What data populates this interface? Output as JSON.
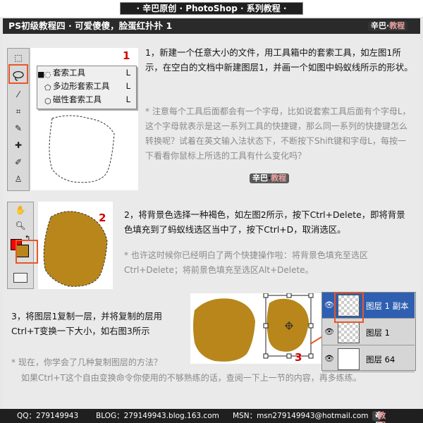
{
  "header": {
    "title": "· 辛巴原创 · PhotoShop · 系列教程 ·",
    "subtitle": "PS初级教程四 · 可爱傻傻，脸蛋红扑扑 1",
    "watermark_a": "辛巴",
    "watermark_b": "教程"
  },
  "step1": {
    "number": "1",
    "text": "1，新建一个任意大小的文件，用工具箱中的套索工具，如左图1所示，在空白的文档中新建图层1，并画一个如图中蚂蚁线所示的形状。",
    "note": "* 注意每个工具后面都会有一个字母，比如说套索工具后面有个字母L，这个字母就表示是这一系列工具的快捷键，那么同一系列的快捷键怎么转换呢？试着在英文输入法状态下，不断按下Shift键和字母L，每按一下看看你鼠标上所选的工具有什么变化吗？",
    "menu": [
      {
        "label": "套索工具",
        "key": "L",
        "icon": "lasso-icon"
      },
      {
        "label": "多边形套索工具",
        "key": "L",
        "icon": "polygon-lasso-icon"
      },
      {
        "label": "磁性套索工具",
        "key": "L",
        "icon": "magnetic-lasso-icon"
      }
    ]
  },
  "step2": {
    "number": "2",
    "text": "2，将背景色选择一种褐色，如左图2所示，按下Ctrl+Delete，即将背景色填充到了蚂蚁线选区当中了，按下Ctrl+D，取消选区。",
    "note": "* 也许这时候你已经明白了两个快捷操作啦：将背景色填充至选区Ctrl+Delete；将前景色填充至选区Alt+Delete。",
    "fill_color": "#b8861b",
    "fg_color": "#ff0000"
  },
  "step3": {
    "number": "3",
    "text": "3，将图层1复制一层，并将复制的层用Ctrl+T变换一下大小，如右图3所示",
    "note1": "* 现在，你学会了几种复制图层的方法？",
    "note2": "如果Ctrl+T这个自由变换命令你使用的不够熟练的话，查阅一下上一节的内容，再多练练。",
    "layers": [
      "图层 1 副本",
      "图层 1",
      "图层 64"
    ],
    "selected_layer_color": "#2f5fb0"
  },
  "footer": {
    "qq": "QQ：279149943",
    "blog": "BLOG：279149943.blog.163.com",
    "msn": "MSN：msn279149943@hotmail.com",
    "brand_a": "辛巴",
    "brand_b": "教程"
  }
}
